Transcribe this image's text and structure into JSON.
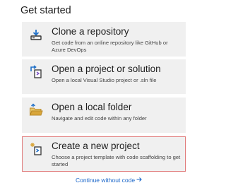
{
  "heading": "Get started",
  "cards": [
    {
      "title": "Clone a repository",
      "description": "Get code from an online repository like GitHub or Azure DevOps",
      "icon": "clone-repository-icon"
    },
    {
      "title": "Open a project or solution",
      "description": "Open a local Visual Studio project or .sln file",
      "icon": "open-project-icon"
    },
    {
      "title": "Open a local folder",
      "description": "Navigate and edit code within any folder",
      "icon": "folder-icon"
    },
    {
      "title": "Create a new project",
      "description": "Choose a project template with code scaffolding to get started",
      "icon": "new-project-icon"
    }
  ],
  "continue_link": "Continue without code",
  "colors": {
    "card_bg": "#f0f0f0",
    "selected_border": "#e07a7a",
    "link": "#1a66c9",
    "accent_blue": "#1e6fc8",
    "folder_yellow": "#d9a63a"
  }
}
